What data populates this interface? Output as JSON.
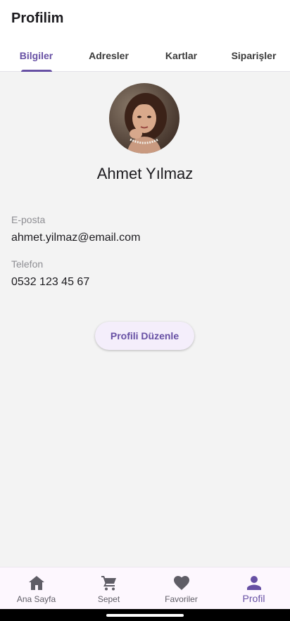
{
  "appbar": {
    "title": "Profilim"
  },
  "tabs": [
    {
      "label": "Bilgiler",
      "active": true
    },
    {
      "label": "Adresler",
      "active": false
    },
    {
      "label": "Kartlar",
      "active": false
    },
    {
      "label": "Siparişler",
      "active": false
    }
  ],
  "profile": {
    "name": "Ahmet Yılmaz",
    "email_label": "E-posta",
    "email": "ahmet.yilmaz@email.com",
    "phone_label": "Telefon",
    "phone": "0532 123 45 67",
    "edit_button": "Profili Düzenle"
  },
  "bottom_nav": [
    {
      "label": "Ana Sayfa",
      "icon": "home-icon",
      "active": false
    },
    {
      "label": "Sepet",
      "icon": "cart-icon",
      "active": false
    },
    {
      "label": "Favoriler",
      "icon": "heart-icon",
      "active": false
    },
    {
      "label": "Profil",
      "icon": "person-icon",
      "active": true
    }
  ],
  "colors": {
    "accent": "#6750a4",
    "background": "#f3f3f3",
    "surface": "#ffffff",
    "nav_background": "#fdf7fe"
  }
}
